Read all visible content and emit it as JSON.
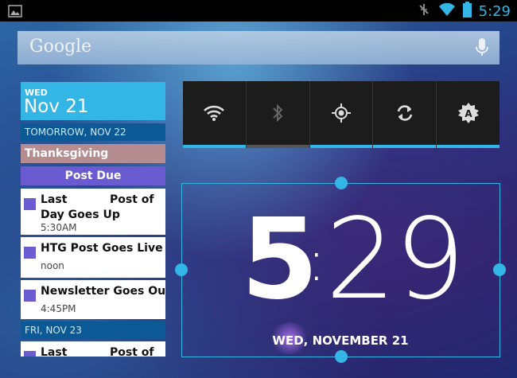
{
  "status_bar": {
    "time": "5:29",
    "left_icon": "image-notification-icon",
    "right_icons": [
      "signal-muted-icon",
      "wifi-icon",
      "battery-icon"
    ]
  },
  "search": {
    "label": "Google",
    "voice_icon": "mic-icon"
  },
  "calendar": {
    "header_dow": "WED",
    "header_date": "Nov 21",
    "section1": "TOMORROW, NOV 22",
    "allday1": "Thanksgiving",
    "allday2": "Post Due",
    "events": [
      {
        "title": "Last           Post of\nDay Goes Up",
        "time": "5:30AM"
      },
      {
        "title": "HTG Post Goes Live",
        "time": "noon"
      },
      {
        "title": "Newsletter Goes Out",
        "time": "4:45PM"
      }
    ],
    "section2": "FRI, NOV 23",
    "next_event_title": "Last           Post of"
  },
  "power_control": {
    "buttons": [
      "wifi-icon",
      "bluetooth-icon",
      "gps-icon",
      "sync-icon",
      "brightness-auto-icon"
    ],
    "states": [
      "on",
      "off",
      "on",
      "on",
      "on"
    ]
  },
  "clock": {
    "hour": "5",
    "colon": ":",
    "minutes": "29",
    "date": "WED, NOVEMBER 21"
  },
  "colors": {
    "accent": "#33b5e5",
    "event": "#6a5bd0",
    "holiday": "#b58d91"
  }
}
